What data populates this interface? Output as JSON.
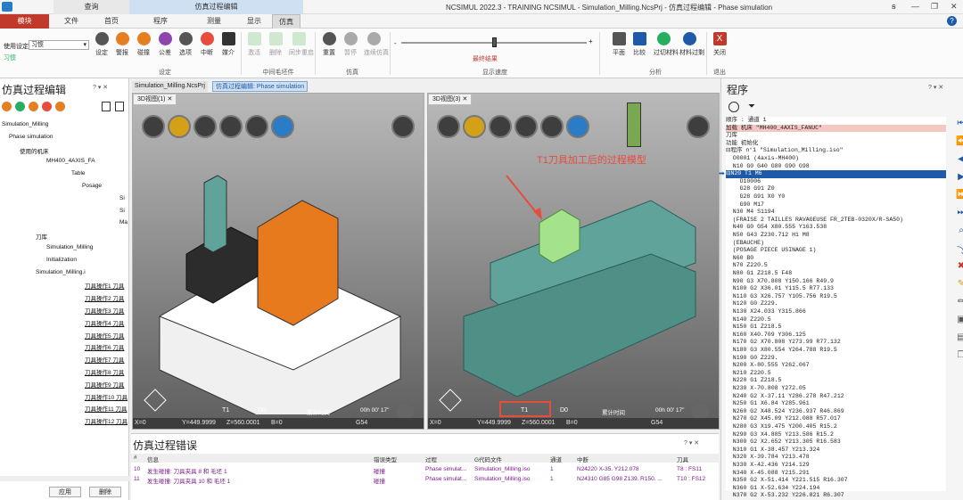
{
  "titlebar": {
    "ctx1": "查询",
    "ctx2": "仿真过程编辑",
    "title": "NCSIMUL 2022.3 - TRAINING NCSIMUL - Simulation_Milling.NcsPrj - 仿真过程编辑 - Phase simulation",
    "min": "—",
    "restore": "❐",
    "close": "✕",
    "pin": "ꞩ"
  },
  "tabs": [
    "模块",
    "文件",
    "首页",
    "程序",
    "测量",
    "显示",
    "仿真"
  ],
  "ribbon": {
    "settings_label": "使用设定",
    "settings_value": "习惯",
    "settings_sub": "习惯",
    "btns": [
      {
        "label": "设定",
        "color": "#555"
      },
      {
        "label": "警报",
        "color": "#e67e22"
      },
      {
        "label": "碰撞",
        "color": "#e67e22"
      },
      {
        "label": "公差",
        "color": "#8e44ad"
      },
      {
        "label": "选项",
        "color": "#555"
      },
      {
        "label": "中断",
        "color": "#e74c3c"
      },
      {
        "label": "媒介",
        "color": "#333"
      },
      {
        "label": "激活",
        "color": "#9bc99b"
      },
      {
        "label": "删除",
        "color": "#9bc99b"
      },
      {
        "label": "同步重启",
        "color": "#9bc99b"
      },
      {
        "label": "重置",
        "color": "#555"
      },
      {
        "label": "暂停",
        "color": "#aaa"
      },
      {
        "label": "连续仿真",
        "color": "#aaa"
      },
      {
        "label": "平面",
        "color": "#555"
      },
      {
        "label": "比较",
        "color": "#1e5aa8"
      },
      {
        "label": "过切材料",
        "color": "#27ae60"
      },
      {
        "label": "材料过剩",
        "color": "#27ae60"
      },
      {
        "label": "关闭",
        "color": "#c0392b"
      }
    ],
    "groups": [
      "设定",
      "中间毛坯件",
      "仿真",
      "显示速度",
      "分析",
      "退出"
    ],
    "final_result": "最终结果",
    "speed": 0.49
  },
  "left": {
    "title": "仿真过程编辑",
    "controls": "? ▾ ✕",
    "tree": [
      "Simulation_Milling",
      "Phase simulation",
      "使用的机床",
      "MH400_4AXIS_FA",
      "Table",
      "Posage",
      "Si",
      "Si",
      "Ma",
      "刀库",
      "Simulation_Milling",
      "Initialization",
      "Simulation_Milling.i",
      "刀具操作1 刀具",
      "刀具操作2 刀具",
      "刀具操作3 刀具",
      "刀具操作4 刀具",
      "刀具操作5 刀具",
      "刀具操作6 刀具",
      "刀具操作7 刀具",
      "刀具操作8 刀具",
      "刀具操作9 刀具",
      "刀具操作10 刀具",
      "刀具操作11 刀具",
      "刀具操作12 刀具"
    ],
    "apply": "应用",
    "delete": "删除"
  },
  "doctabs": [
    "Simulation_Milling.NcsPrj",
    "仿真过程编辑: Phase simulation"
  ],
  "view1": {
    "tab": "3D视图(1)",
    "t": "T1",
    "d": "D0",
    "time_label": "累计时间",
    "time": "00h 00' 17\"",
    "x": "X=0",
    "y": "Y=449.9999",
    "z": "Z=560.0001",
    "b": "B=0",
    "g": "G54"
  },
  "view2": {
    "tab": "3D视图(3)",
    "annotation": "T1刀具加工后的过程模型",
    "t": "T1",
    "d": "D0",
    "time_label": "累计时间",
    "time": "00h 00' 17\"",
    "x": "X=0",
    "y": "Y=449.9999",
    "z": "Z=560.0001",
    "b": "B=0",
    "g": "G54"
  },
  "errors": {
    "title": "仿真过程错误",
    "controls": "? ▾ ✕",
    "headers": [
      "#",
      "信息",
      "错误类型",
      "过程",
      "G代码文件",
      "通道",
      "中断",
      "刀具"
    ],
    "rows": [
      [
        "10",
        "发生碰撞: 刀具夹具 8 和 毛坯 1",
        "碰撞",
        "Phase simulat...",
        "Simulation_Milling.iso",
        "1",
        "N24220 X-35. Y212.078",
        "T8 : FS11"
      ],
      [
        "11",
        "发生碰撞: 刀具夹具 10 和 毛坯 1",
        "碰撞",
        "Phase simulat...",
        "Simulation_Milling.iso",
        "1",
        "N24310 G85 G98 Z139. R150. ...",
        "T10 : FS12"
      ]
    ]
  },
  "program": {
    "title": "程序",
    "controls": "? ▾ ✕",
    "lines": [
      "顺序 : 通道 1",
      "加载 机床 \"MH400_4AXIS_FANUC\"",
      "刀库",
      "功能 初始化",
      "⊟程序 n°1 \"Simulation_Milling.iso\"",
      "  O0001 (4axis-MH400)",
      "  N10 G0 G40 G80 G90 G98",
      "⊟N20 T1 M6",
      "    O10006",
      "    G28 G91 Z0",
      "    G28 G91 X0 Y0",
      "    G90 M17",
      "  N30 M4 S1194",
      "  (FRAISE 2 TAILLES RAVAGEUSE FR_2TEB-0320X/R-SA50)",
      "  N40 G0 G54 X80.555 Y163.538",
      "  N50 G43 Z230.712 H1 M8",
      "  (EBAUCHE)",
      "  (POSAGE PIECE USINAGE 1)",
      "  N60 B0",
      "  N70 Z220.5",
      "  N80 G1 Z218.5 F48",
      "  N90 G3 X70.808 Y150.166 R49.9",
      "  N100 G2 X36.01 Y115.5 R77.133",
      "  N110 G3 X26.757 Y105.756 R19.5",
      "  N120 G0 Z229.",
      "  N130 X24.033 Y315.866",
      "  N140 Z220.5",
      "  N150 G1 Z218.5",
      "  N160 X40.709 Y306.125",
      "  N170 G2 X70.808 Y273.99 R77.132",
      "  N180 G3 X80.554 Y264.788 R19.5",
      "  N190 G0 Z229.",
      "  N200 X-80.555 Y262.067",
      "  N210 Z220.5",
      "  N220 G1 Z218.5",
      "  N230 X-70.808 Y272.05",
      "  N240 G2 X-37.11 Y286.278 R47.212",
      "  N250 G1 X6.84 Y285.961",
      "  N260 G2 X48.524 Y236.937 R46.869",
      "  N270 G2 X45.09 Y212.088 R57.017",
      "  N280 G3 X19.475 Y200.405 R15.2",
      "  N290 G3 X4.885 Y213.586 R15.2",
      "  N300 G2 X2.652 Y213.305 R16.583",
      "  N310 G1 X-38.457 Y213.324",
      "  N320 X-39.784 Y213.478",
      "  N330 X-42.436 Y214.129",
      "  N340 X-45.088 Y215.291",
      "  N350 G2 X-51.414 Y221.515 R16.307",
      "  N360 G1 X-52.634 Y224.194",
      "  N370 G2 X-53.232 Y226.821 R6.307"
    ],
    "active_index": 7
  }
}
